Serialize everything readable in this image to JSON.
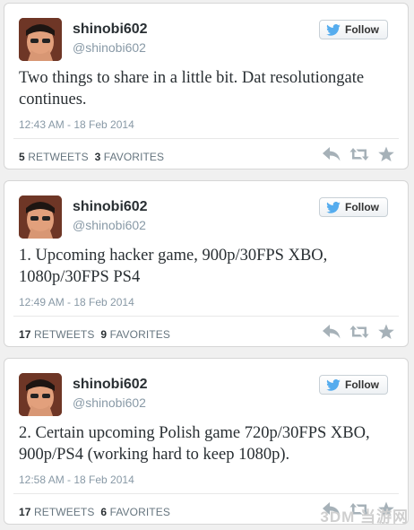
{
  "tweets": [
    {
      "name": "shinobi602",
      "handle": "@shinobi602",
      "follow_label": "Follow",
      "text": "Two things to share in a little bit. Dat resolutiongate continues.",
      "time": "12:43 AM - 18 Feb 2014",
      "retweets": "5",
      "retweets_label": "RETWEETS",
      "favorites": "3",
      "favorites_label": "FAVORITES"
    },
    {
      "name": "shinobi602",
      "handle": "@shinobi602",
      "follow_label": "Follow",
      "text": "1. Upcoming hacker game, 900p/30FPS XBO, 1080p/30FPS PS4",
      "time": "12:49 AM - 18 Feb 2014",
      "retweets": "17",
      "retweets_label": "RETWEETS",
      "favorites": "9",
      "favorites_label": "FAVORITES"
    },
    {
      "name": "shinobi602",
      "handle": "@shinobi602",
      "follow_label": "Follow",
      "text": "2. Certain upcoming Polish game 720p/30FPS XBO, 900p/PS4 (working hard to keep 1080p).",
      "time": "12:58 AM - 18 Feb 2014",
      "retweets": "17",
      "retweets_label": "RETWEETS",
      "favorites": "6",
      "favorites_label": "FAVORITES"
    }
  ],
  "icons": {
    "follow": "twitter-bird-icon",
    "reply": "reply-icon",
    "retweet": "retweet-icon",
    "favorite": "star-icon"
  },
  "colors": {
    "twitter_blue": "#55acee",
    "icon_gray": "#a6b1b8"
  },
  "watermark": "3DM 当游网"
}
